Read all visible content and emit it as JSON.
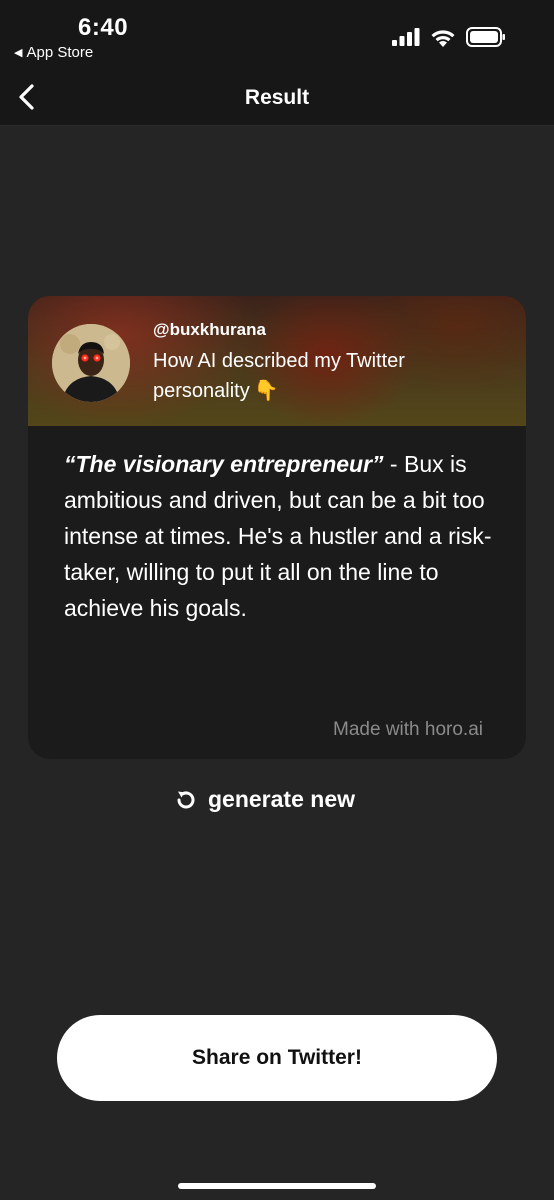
{
  "status_bar": {
    "time": "6:40",
    "back_app": "App Store",
    "back_icon": "back-triangle-icon",
    "signal_icon": "signal-icon",
    "wifi_icon": "wifi-icon",
    "battery_icon": "battery-icon"
  },
  "nav": {
    "title": "Result",
    "back_icon": "chevron-left-icon"
  },
  "card": {
    "handle": "@buxkhurana",
    "description": "How AI described my Twitter personality",
    "pointer_emoji": "👇",
    "quote_title": "“The visionary entrepreneur”",
    "quote_body": " - Bux is ambitious and driven, but can be a bit too intense at times. He's a hustler and a risk-taker, willing to put it all on the line to achieve his goals.",
    "footer": "Made with horo.ai"
  },
  "generate": {
    "label": "generate new",
    "icon": "refresh-icon"
  },
  "share_button": {
    "label": "Share on Twitter!"
  },
  "colors": {
    "background": "#252525",
    "top_bar": "#171717",
    "card": "#1b1b1b",
    "muted_text": "#8a8a8a",
    "button_bg": "#ffffff",
    "button_text": "#111111"
  }
}
